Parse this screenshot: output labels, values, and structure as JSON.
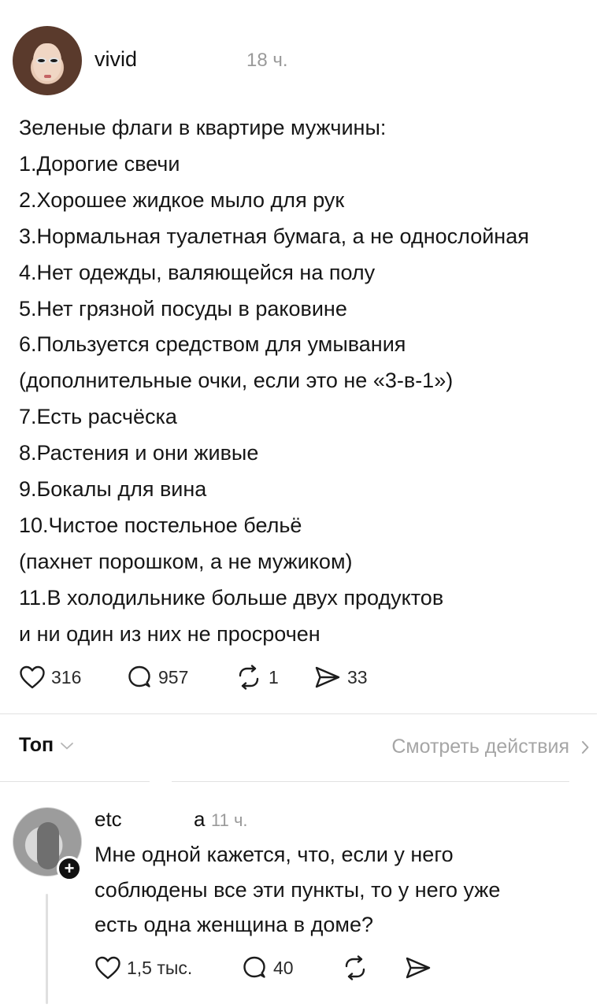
{
  "post": {
    "username": "vivid",
    "time": "18 ч.",
    "lines": [
      "Зеленые флаги в квартире мужчины:",
      "1.Дорогие свечи",
      "2.Хорошее жидкое мыло для рук",
      "3.Нормальная туалетная бумага, а не однослойная",
      "4.Нет одежды, валяющейся на полу",
      "5.Нет грязной посуды в раковине",
      "6.Пользуется средством для умывания",
      "(дополнительные очки, если это не «3-в-1»)",
      "7.Есть расчёска",
      "8.Растения и они живые",
      "9.Бокалы для вина",
      "10.Чистое постельное бельё",
      "(пахнет порошком, а не мужиком)",
      "11.В холодильнике больше двух продуктов",
      "и ни один из них не просрочен"
    ],
    "likes": "316",
    "comments": "957",
    "reposts": "1",
    "shares": "33"
  },
  "toolbar": {
    "sort_label": "Топ",
    "view_actions_label": "Смотреть действия"
  },
  "reply": {
    "username": "etc",
    "username_tail": "a",
    "time": "11 ч.",
    "follow_symbol": "+",
    "lines": [
      "Мне одной кажется, что, если у него",
      "соблюдены все эти пункты, то у него уже",
      "есть одна женщина в доме?"
    ],
    "likes": "1,5 тыс.",
    "comments": "40"
  },
  "icons": {
    "like": "heart-icon",
    "comment": "speech-bubble-icon",
    "repost": "repost-icon",
    "share": "send-icon",
    "sort": "chevron-down-icon",
    "view": "chevron-right-icon"
  },
  "colors": {
    "text": "#161616",
    "muted": "#9a9a9a",
    "divider": "#e2e2e2"
  }
}
